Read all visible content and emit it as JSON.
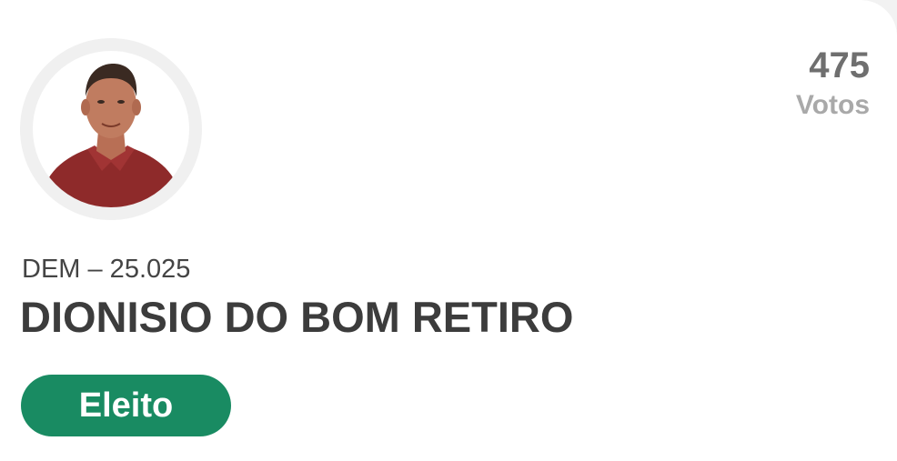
{
  "candidate": {
    "party_number": "DEM – 25.025",
    "name": "DIONISIO DO BOM RETIRO",
    "status": "Eleito"
  },
  "votes": {
    "count": "475",
    "label": "Votos"
  },
  "colors": {
    "status_badge": "#198b62",
    "votes_count": "#6f6f6f",
    "votes_label": "#a9a9a9",
    "name_text": "#3c3c3c"
  },
  "icons": {
    "avatar": "candidate-photo"
  }
}
